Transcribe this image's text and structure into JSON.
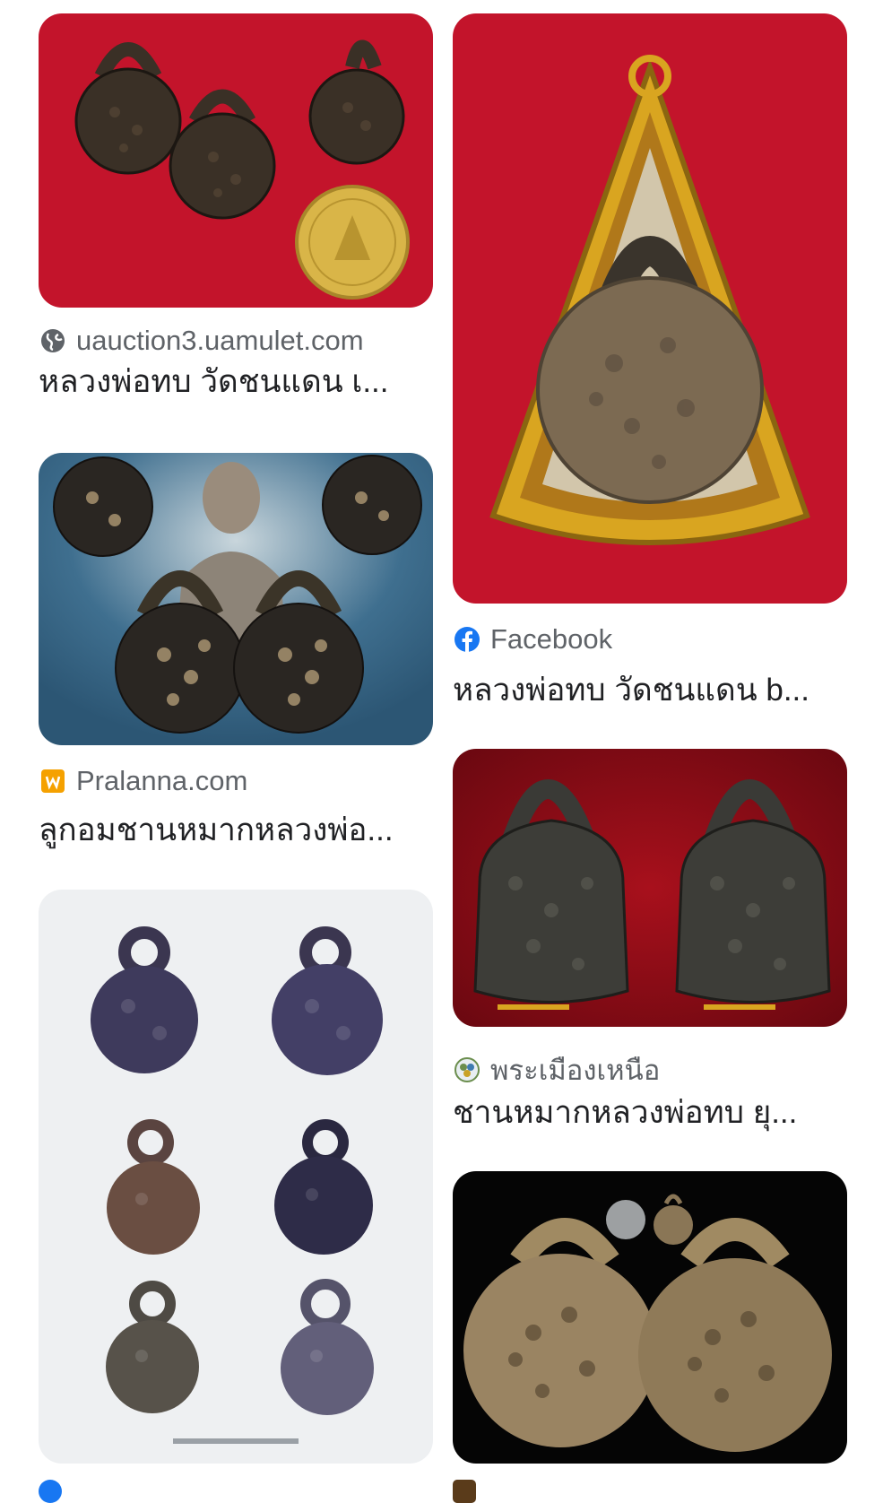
{
  "results": [
    {
      "source": "uauction3.uamulet.com",
      "source_icon": "globe-icon",
      "title": "หลวงพ่อทบ วัดชนแดน เ...",
      "image_desc": "three woven amulet balls and gold coin on red background"
    },
    {
      "source": "Facebook",
      "source_icon": "facebook-icon",
      "title": "หลวงพ่อทบ วัดชนแดน b...",
      "image_desc": "woven ball amulet in gold frame on red background"
    },
    {
      "source": "Pralanna.com",
      "source_icon": "pralanna-icon",
      "title": "ลูกอมชานหมากหลวงพ่อ...",
      "image_desc": "monk portrait with woven amulet balls on blue background"
    },
    {
      "source": "พระเมืองเหนือ",
      "source_icon": "site-logo-icon",
      "title": "ชานหมากหลวงพ่อทบ ยุ...",
      "image_desc": "two dark woven amulets on red background"
    },
    {
      "image_desc": "six woven amulets on white background"
    },
    {
      "image_desc": "two large woven amulets with coin on black background"
    }
  ],
  "colors": {
    "red_bg": "#c3142b",
    "dark_red_bg": "#7d0a12",
    "blue_bg": "#3f6f8f",
    "gold": "#d9a520"
  }
}
